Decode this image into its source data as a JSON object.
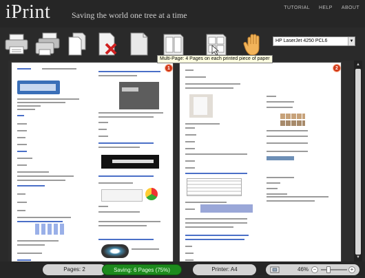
{
  "app": {
    "name": "iPrint",
    "tagline": "Saving the world one tree at a time"
  },
  "topnav": [
    "TUTORIAL",
    "HELP",
    "ABOUT"
  ],
  "toolbar": {
    "tooltip": "Multi-Page: 4 Pages on each printed piece of paper",
    "printer_selected": "HP LaserJet 4250 PCL6"
  },
  "pages": [
    {
      "number": "1"
    },
    {
      "number": "2"
    }
  ],
  "footer": {
    "pages": "Pages: 2",
    "saving": "Saving: 6 Pages (75%)",
    "printer": "Printer: A4",
    "zoom": "46%"
  },
  "colors": {
    "saving_green": "#1d8a1d",
    "badge_red": "#d03a1a",
    "link_blue": "#4a6fc7"
  }
}
